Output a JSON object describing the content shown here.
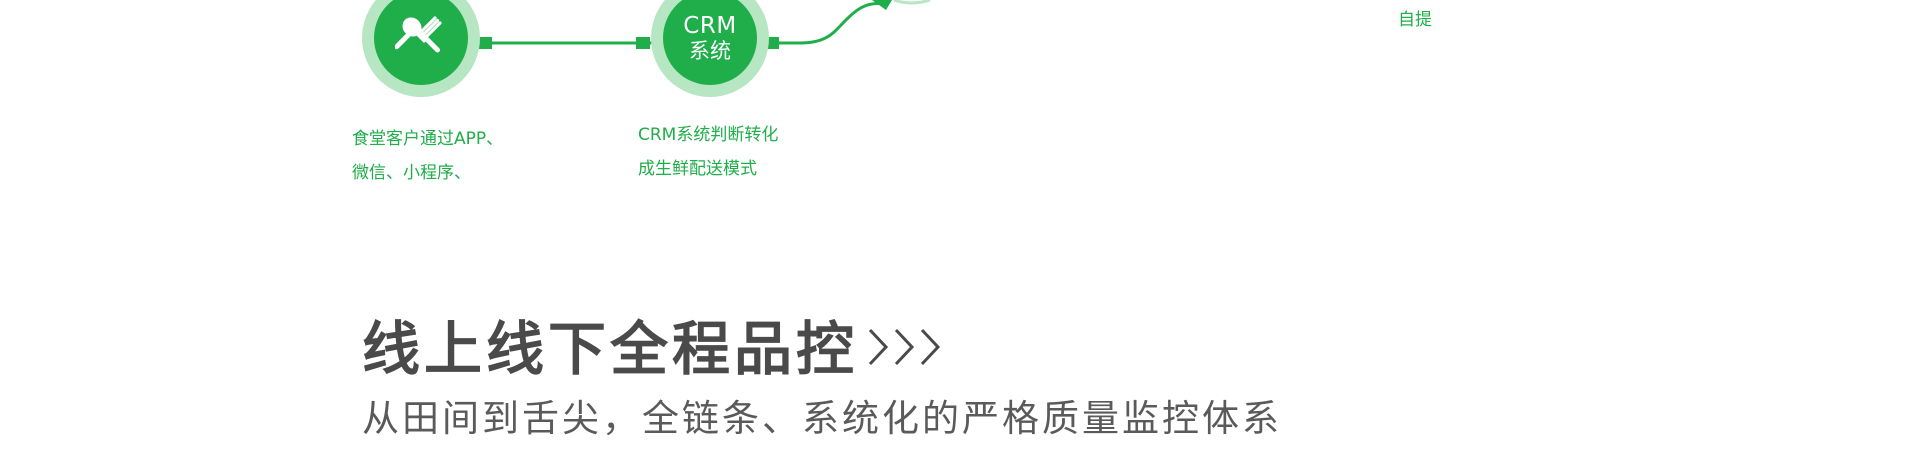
{
  "flow": {
    "nodes": [
      {
        "icon": "utensils-icon",
        "caption_lines": [
          "食堂客户通过APP、",
          "微信、小程序、"
        ]
      },
      {
        "title_top": "CRM",
        "title_bottom": "系统",
        "caption_lines": [
          "CRM系统判断转化",
          "成生鲜配送模式"
        ]
      }
    ],
    "corner_label": "自提"
  },
  "section": {
    "title": "线上线下全程品控",
    "chevrons_icon": "triple-chevron-right-icon",
    "subtitle": "从田间到舌尖，全链条、系统化的严格质量监控体系"
  },
  "colors": {
    "brand_green": "#1fae4a",
    "halo_green": "#b7e6c3",
    "title_gray": "#4a4a4a",
    "subtitle_gray": "#5a5a5a"
  }
}
